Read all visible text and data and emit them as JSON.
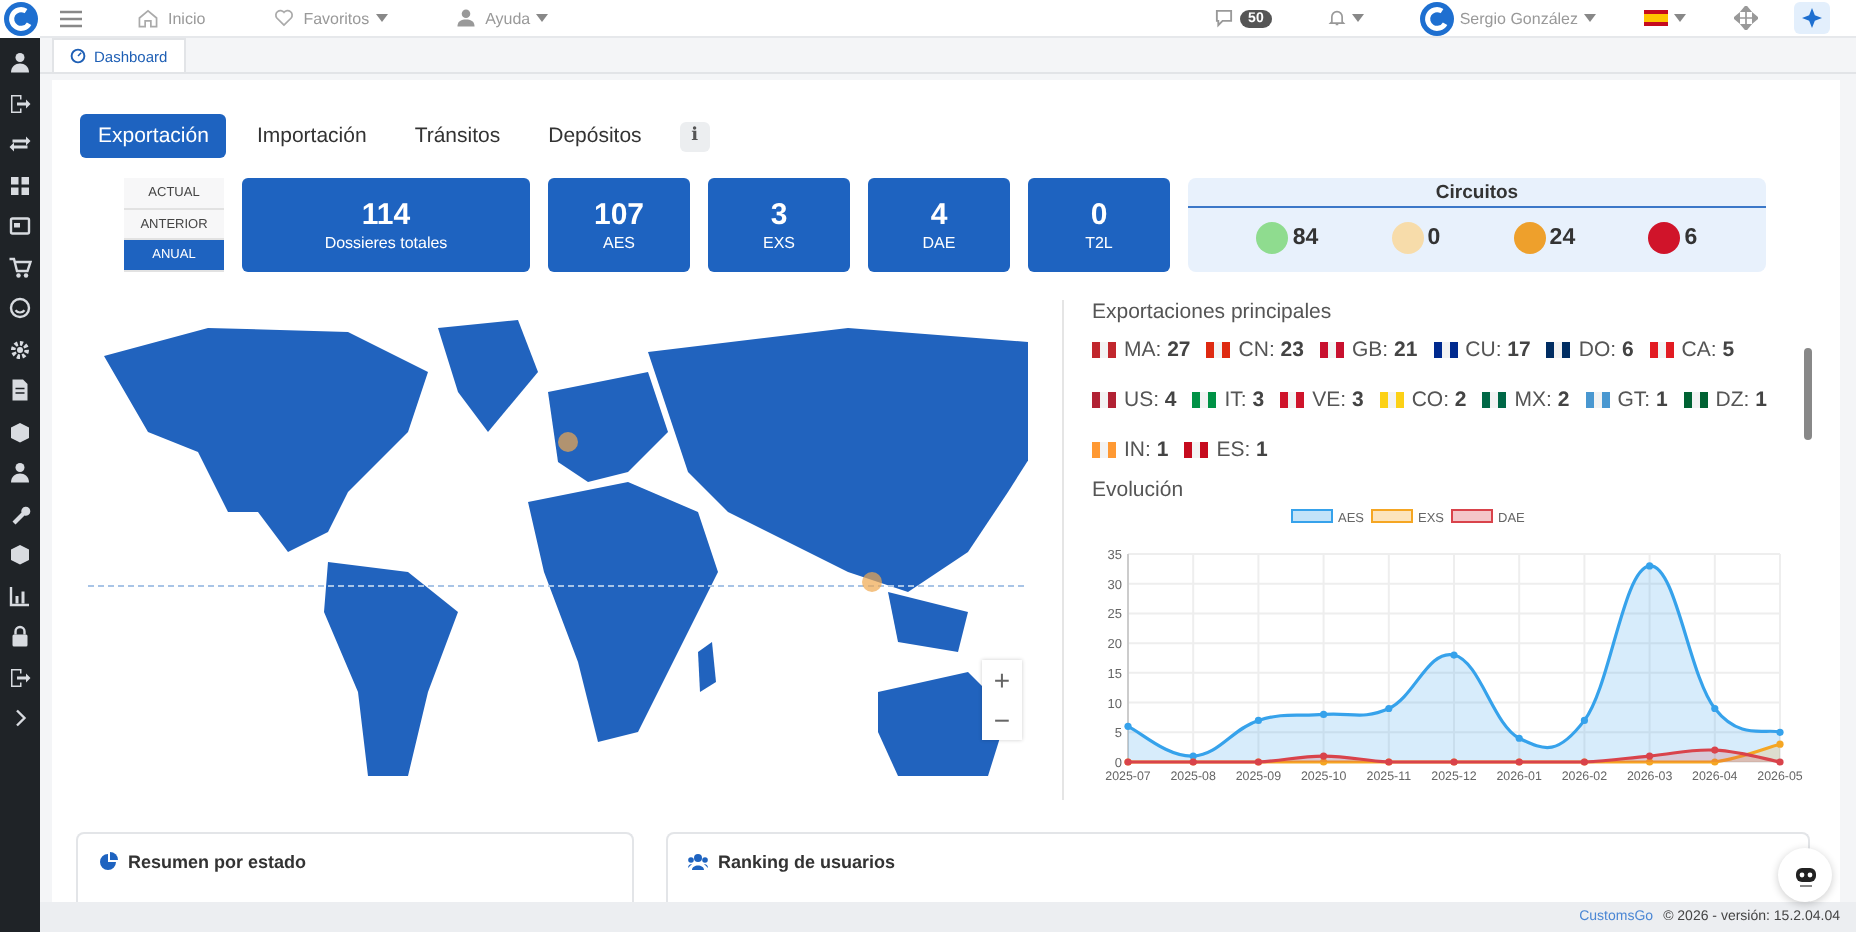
{
  "topbar": {
    "nav": [
      {
        "label": "Inicio",
        "kind": "home"
      },
      {
        "label": "Favoritos",
        "kind": "favorites"
      },
      {
        "label": "Ayuda",
        "kind": "help"
      }
    ],
    "messages_badge": "50",
    "user": "Sergio González"
  },
  "page_tabs": [
    {
      "label": "Dashboard",
      "selected": true
    }
  ],
  "tabs": [
    {
      "label": "Exportación",
      "selected": true
    },
    {
      "label": "Importación",
      "selected": false
    },
    {
      "label": "Tránsitos",
      "selected": false
    },
    {
      "label": "Depósitos",
      "selected": false
    }
  ],
  "info_button": "i",
  "period": [
    {
      "label": "ACTUAL",
      "selected": false
    },
    {
      "label": "ANTERIOR",
      "selected": false
    },
    {
      "label": "ANUAL",
      "selected": true
    }
  ],
  "stats": [
    {
      "value": "114",
      "label": "Dossieres totales"
    },
    {
      "value": "107",
      "label": "AES"
    },
    {
      "value": "3",
      "label": "EXS"
    },
    {
      "value": "4",
      "label": "DAE"
    },
    {
      "value": "0",
      "label": "T2L"
    }
  ],
  "circuits": {
    "title": "Circuitos",
    "items": [
      {
        "value": "84",
        "color": "#8fdc8f"
      },
      {
        "value": "0",
        "color": "#f7dcaa"
      },
      {
        "value": "24",
        "color": "#eea02c"
      },
      {
        "value": "6",
        "color": "#d0142a"
      }
    ]
  },
  "map": {
    "kind": "picture",
    "zoom": [
      "+",
      "−"
    ]
  },
  "top_exports": {
    "title": "Exportaciones principales",
    "items": [
      {
        "text": "MA: **27**",
        "color": "#c1272d"
      },
      {
        "text": "CN: **23**",
        "color": "#de2910"
      },
      {
        "text": "GB: **21**",
        "color": "#c8102e"
      },
      {
        "text": "CU: **17**",
        "color": "#002a8f"
      },
      {
        "text": "DO: **6**",
        "color": "#002d62"
      },
      {
        "text": "CA: **5**",
        "color": "#e21b22"
      },
      {
        "text": "US: **4**",
        "color": "#b22234"
      },
      {
        "text": "IT: **3**",
        "color": "#009246"
      },
      {
        "text": "VE: **3**",
        "color": "#cf142b"
      },
      {
        "text": "CO: **2**",
        "color": "#fcd116"
      },
      {
        "text": "MX: **2**",
        "color": "#006847"
      },
      {
        "text": "GT: **1**",
        "color": "#4997d0"
      },
      {
        "text": "DZ: **1**",
        "color": "#006233"
      },
      {
        "text": "IN: **1**",
        "color": "#ff9933"
      },
      {
        "text": "ES: **1**",
        "color": "#c60b1e"
      }
    ]
  },
  "evolution": {
    "title": "Evolución",
    "chart_data": {
      "type": "area",
      "categories": [
        "2025-07",
        "2025-08",
        "2025-09",
        "2025-10",
        "2025-11",
        "2025-12",
        "2026-01",
        "2026-02",
        "2026-03",
        "2026-04",
        "2026-05"
      ],
      "series": [
        {
          "name": "AES",
          "color": "#36a2eb",
          "values": [
            6,
            1,
            7,
            8,
            9,
            18,
            4,
            7,
            33,
            9,
            5
          ]
        },
        {
          "name": "EXS",
          "color": "#f5a623",
          "values": [
            0,
            0,
            0,
            0,
            0,
            0,
            0,
            0,
            0,
            0,
            3
          ]
        },
        {
          "name": "DAE",
          "color": "#d9434b",
          "values": [
            0,
            0,
            0,
            1,
            0,
            0,
            0,
            0,
            1,
            2,
            0
          ]
        }
      ],
      "ylim": [
        0,
        35
      ],
      "yticks": [
        0,
        5,
        10,
        15,
        20,
        25,
        30,
        35
      ],
      "grid": true,
      "legend": true
    }
  },
  "panels": [
    {
      "title": "Resumen por estado",
      "kind": "pie"
    },
    {
      "title": "Ranking de usuarios",
      "kind": "users"
    }
  ],
  "footer": {
    "link": "CustomsGo",
    "text": "© 2026 - versión: 15.2.04.04"
  }
}
